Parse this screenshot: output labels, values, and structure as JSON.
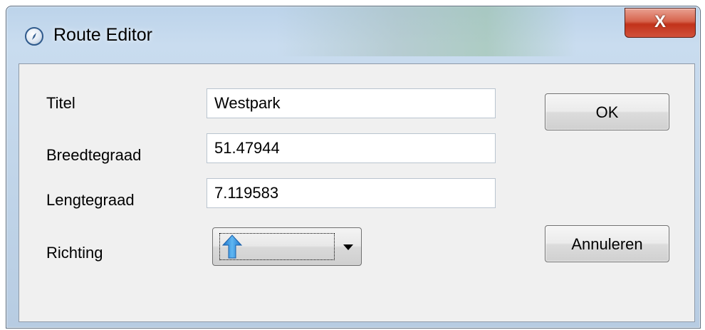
{
  "window": {
    "title": "Route Editor",
    "close_label": "X",
    "icon": "compass-icon"
  },
  "form": {
    "title_label": "Titel",
    "title_value": "Westpark",
    "latitude_label": "Breedtegraad",
    "latitude_value": "51.47944",
    "longitude_label": "Lengtegraad",
    "longitude_value": "7.119583",
    "direction_label": "Richting",
    "direction_icon": "arrow-up-icon"
  },
  "buttons": {
    "ok_label": "OK",
    "cancel_label": "Annuleren"
  }
}
